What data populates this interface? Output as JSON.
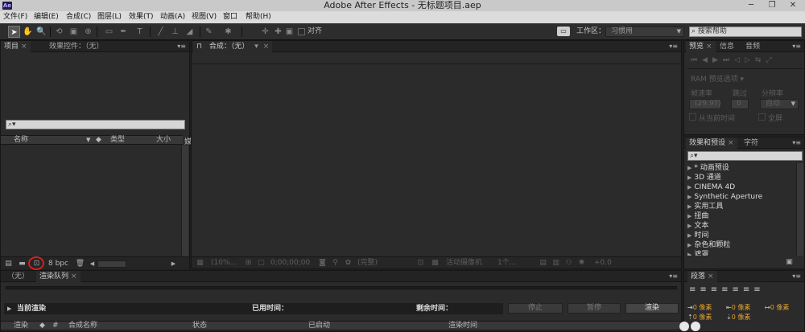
{
  "window": {
    "title": "Adobe After Effects - 无标题项目.aep",
    "logo": "Ae",
    "controls": {
      "minimize": "─",
      "restore": "❐",
      "close": "✕"
    }
  },
  "menu": [
    "文件(F)",
    "编辑(E)",
    "合成(C)",
    "图层(L)",
    "效果(T)",
    "动画(A)",
    "视图(V)",
    "窗口",
    "帮助(H)"
  ],
  "toolbar": {
    "snap_label": "对齐",
    "workspace_label": "工作区：",
    "workspace_value": "习惯用",
    "help_search": "搜索帮助"
  },
  "project_panel": {
    "tabs": [
      "项目",
      "效果控件：（无）"
    ],
    "search_glyph": "⌕▾",
    "columns": [
      "名称",
      "类型",
      "大小",
      "媒"
    ],
    "bpc": "8 bpc"
  },
  "comp_panel": {
    "tab": "合成：（无）",
    "lock_glyph": "🔓",
    "zoom": "(10%...",
    "timecode": "0;00;00;00",
    "quality": "(完整)",
    "view_label": "活动摄像机",
    "views": "1个...",
    "offset": "+0.0"
  },
  "preview_panel": {
    "tabs": [
      "预览",
      "信息",
      "音频"
    ],
    "section": "RAM 预览选项",
    "labels": {
      "fps": "帧速率",
      "skip": "跳过",
      "res": "分辨率"
    },
    "values": {
      "fps": "(29.97)",
      "skip": "0",
      "res": "自动"
    },
    "from_current": "从当前时间",
    "fullscreen": "全屏"
  },
  "effects_panel": {
    "tabs": [
      "效果和预设",
      "字符"
    ],
    "items": [
      "* 动画预设",
      "3D 通道",
      "CINEMA 4D",
      "Synthetic Aperture",
      "实用工具",
      "扭曲",
      "文本",
      "时间",
      "杂色和颗粒",
      "遮罩"
    ]
  },
  "render_panel": {
    "tabs": [
      "（无）",
      "渲染队列"
    ],
    "current_render": "当前渲染",
    "elapsed": "已用时间：",
    "remaining": "剩余时间：",
    "buttons": [
      "停止",
      "暂停",
      "渲染"
    ],
    "columns": [
      "渲染",
      "#",
      "合成名称",
      "状态",
      "已启动",
      "渲染时间"
    ]
  },
  "paragraph_panel": {
    "tab": "段落",
    "values": [
      "0 像素",
      "0 像素",
      "0 像素",
      "0 像素",
      "0 像素"
    ]
  },
  "colors": {
    "bg": "#1f1f1f",
    "panel": "#2b2b2b",
    "highlight_circle": "#d42020"
  }
}
